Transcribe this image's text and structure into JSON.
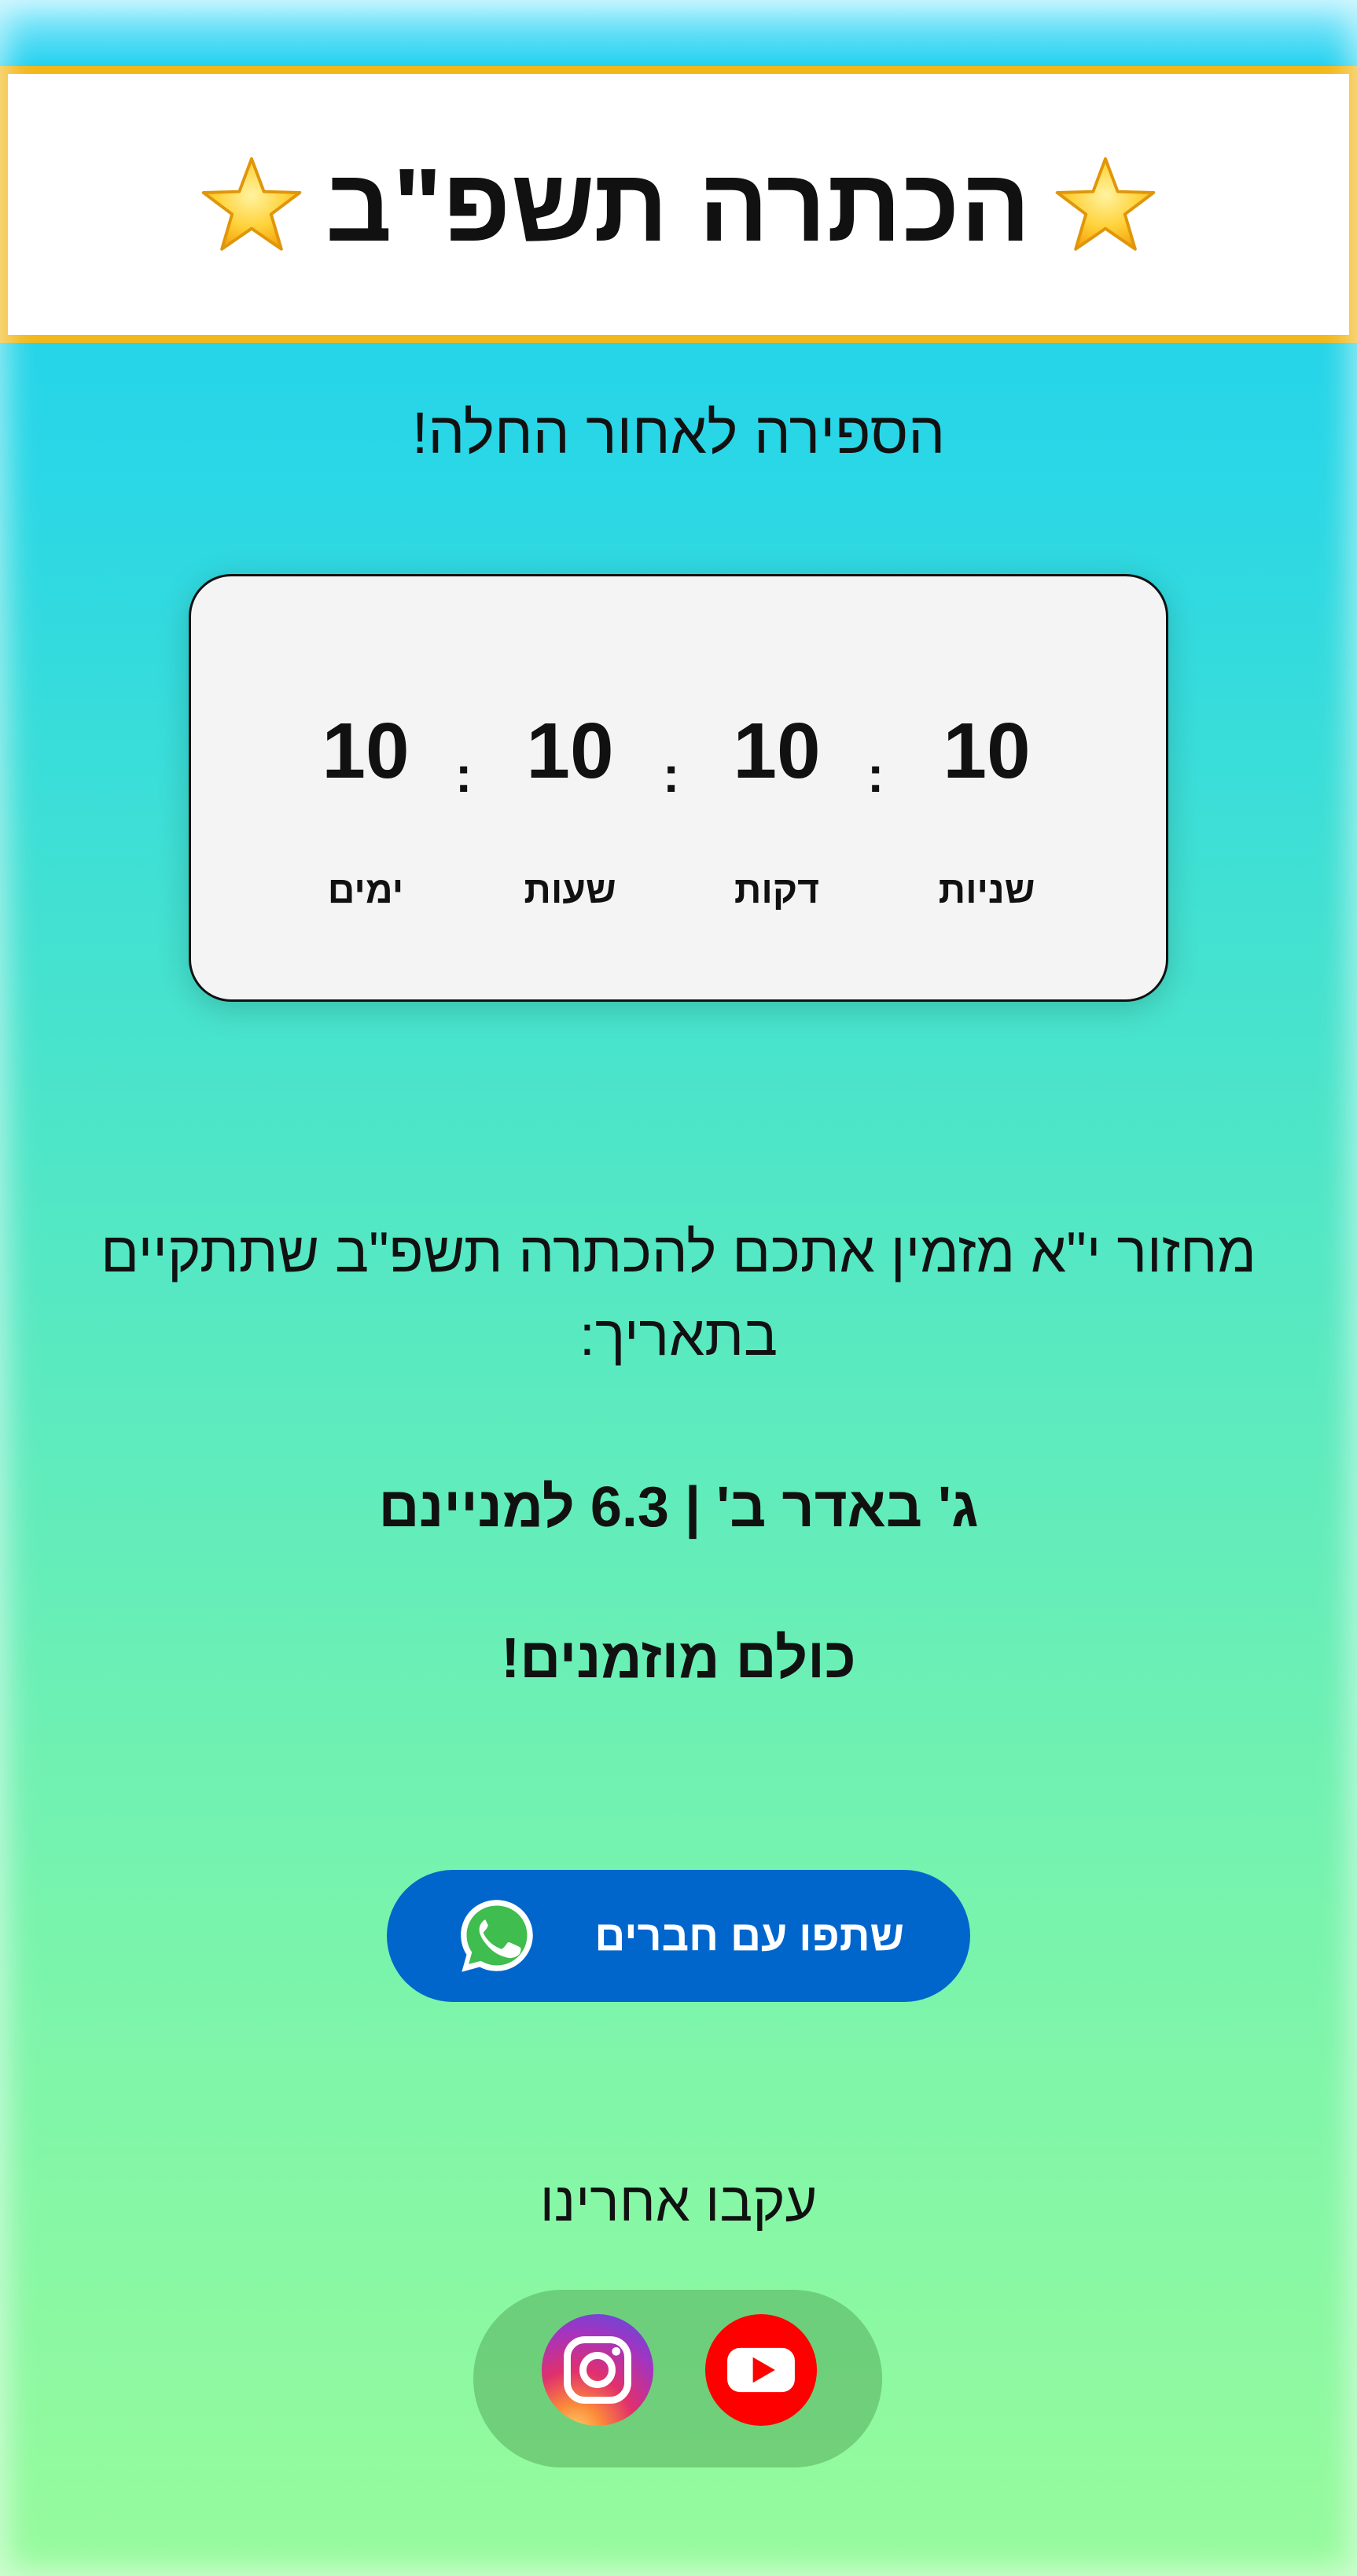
{
  "header": {
    "title": "הכתרה תשפ\"ב",
    "left_icon": "star-icon",
    "right_icon": "star-icon",
    "border_color": "#f2b81a"
  },
  "subtitle": "הספירה לאחור החלה!",
  "countdown": {
    "units": [
      {
        "value": "10",
        "label": "ימים"
      },
      {
        "value": "10",
        "label": "שעות"
      },
      {
        "value": "10",
        "label": "דקות"
      },
      {
        "value": "10",
        "label": "שניות"
      }
    ],
    "separator": ":"
  },
  "invite": {
    "text": "מחזור י\"א מזמין אתכם להכתרה תשפ\"ב שתתקיים בתאריך:",
    "date": "ג' באדר ב' | 6.3 למניינם",
    "welcome": "כולם מוזמנים!"
  },
  "share": {
    "label": "שתפו עם חברים",
    "icon": "whatsapp-icon",
    "color": "#0066cc"
  },
  "follow": {
    "label": "עקבו אחרינו",
    "icons": [
      "instagram-icon",
      "youtube-icon"
    ]
  }
}
